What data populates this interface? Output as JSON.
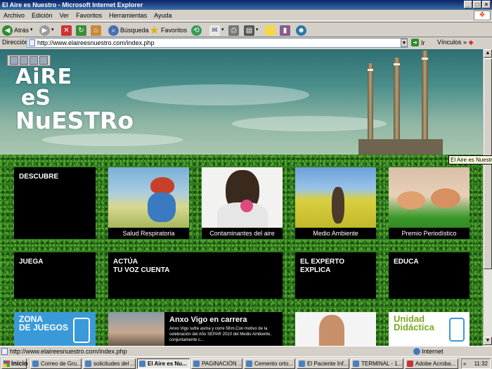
{
  "window": {
    "title": "El Aire es Nuestro - Microsoft Internet Explorer"
  },
  "menu": [
    "Archivo",
    "Edición",
    "Ver",
    "Favoritos",
    "Herramientas",
    "Ayuda"
  ],
  "toolbar": {
    "back": "Atrás",
    "search": "Búsqueda",
    "favorites": "Favoritos"
  },
  "address": {
    "label": "Dirección",
    "url": "http://www.elaireesnuestro.com/index.php",
    "go": "Ir",
    "links": "Vínculos"
  },
  "site": {
    "logo_l1": "AiRE",
    "logo_l2": "eS",
    "logo_l3": "NuESTRo",
    "tooltip": "El Aire es Nuestro"
  },
  "row1": {
    "discover": "DESCUBRE",
    "photos": [
      "Salud Respiratoria",
      "Contaminantes del aire",
      "Medio Ambiente",
      "Premio Periodístico"
    ]
  },
  "row2": {
    "play": "JUEGA",
    "act": "ACTÚA\nTU VOZ CUENTA",
    "expert": "EL EXPERTO\nEXPLICA",
    "educate": "EDUCA"
  },
  "row3": {
    "zone": "ZONA\nDE JUEGOS",
    "news_title": "Anxo Vigo en carrera",
    "news_body": "Anxo Vigo sufre asma y corre 5Km.Con motivo de la celebración del Año SEPAR 2010 del Medio Ambiente, conjuntamente c...",
    "unit": "Unidad\nDidáctica"
  },
  "status": {
    "url": "http://www.elaireesnuestro.com/index.php",
    "zone": "Internet"
  },
  "taskbar": {
    "start": "Inicio",
    "tasks": [
      "Correo de Gru...",
      "solicitudes del ...",
      "El Aire es Nu...",
      "PAGINACIÓN ...",
      "Cemento orto...",
      "El Paciente Inf...",
      "TERMINAL - 1...",
      "Adobe Acroba..."
    ],
    "time": "11:32"
  }
}
